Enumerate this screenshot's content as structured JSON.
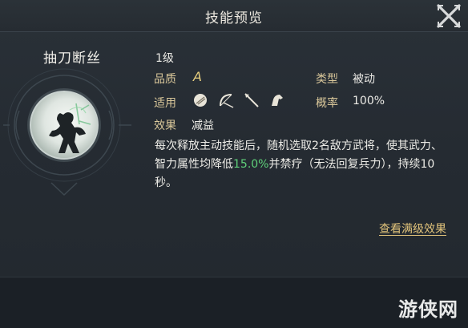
{
  "header": {
    "title": "技能预览"
  },
  "skill": {
    "name": "抽刀断丝",
    "level": "1级",
    "quality_label": "品质",
    "quality_value": "A",
    "type_label": "类型",
    "type_value": "被动",
    "apply_label": "适用",
    "apply_icons": [
      "shield-icon",
      "bow-icon",
      "spear-icon",
      "horse-icon"
    ],
    "rate_label": "概率",
    "rate_value": "100%",
    "effect_label": "效果",
    "effect_value": "减益",
    "desc_part1": "每次释放主动技能后，随机选取2名敌方武将，使其武力、智力属性均降低",
    "desc_highlight": "15.0%",
    "desc_part2": "并禁疗（无法回复兵力），持续10秒。"
  },
  "actions": {
    "full_level_link": "查看满级效果"
  },
  "watermark": "游侠网",
  "colors": {
    "label": "#d9c79a",
    "highlight": "#5fd07a",
    "link": "#e0c27a"
  }
}
